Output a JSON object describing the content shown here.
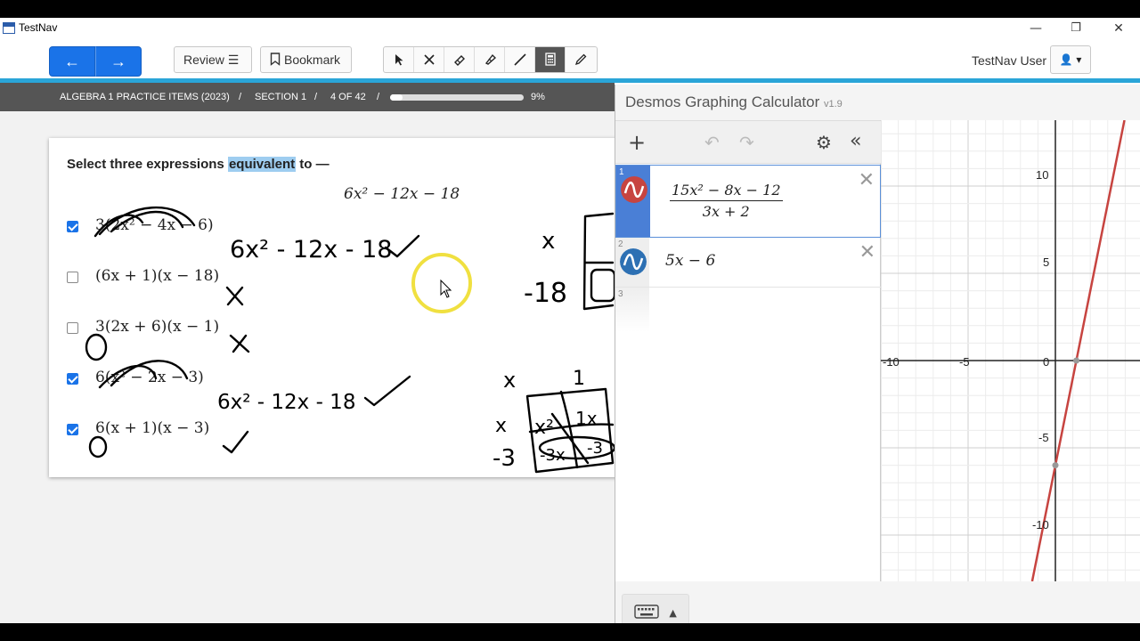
{
  "window": {
    "app_title": "TestNav",
    "minimize": "—",
    "restore": "❐",
    "close": "✕"
  },
  "toolbar": {
    "back": "←",
    "forward": "→",
    "review_label": "Review",
    "bookmark_label": "Bookmark",
    "user_name": "TestNav User",
    "user_menu": "👤 ▾"
  },
  "section_bar": {
    "course": "ALGEBRA 1 PRACTICE ITEMS (2023)",
    "section": "SECTION 1",
    "position": "4 OF 42",
    "percent_text": "9%",
    "progress": 0.09
  },
  "question": {
    "prefix": "Select three expressions ",
    "highlight": "equivalent",
    "suffix": " to —",
    "target": "6x² − 12x − 18",
    "options": [
      {
        "text": "3(2x² − 4x − 6)",
        "checked": true
      },
      {
        "text": "(6x + 1)(x − 18)",
        "checked": false
      },
      {
        "text": "3(2x + 6)(x − 1)",
        "checked": false
      },
      {
        "text": "6(x² − 2x − 3)",
        "checked": true
      },
      {
        "text": "6(x + 1)(x − 3)",
        "checked": true
      }
    ]
  },
  "annotations": {
    "work1": "6x² - 12x - 18",
    "work2": "6x² - 12x - 18",
    "box_labels": [
      "x",
      "1",
      "x",
      "-3",
      "x²",
      "1x",
      "-3x",
      "-3"
    ],
    "side_labels": [
      "x",
      "-18"
    ]
  },
  "desmos": {
    "title": "Desmos Graphing Calculator",
    "version": "v1.9",
    "expressions": [
      {
        "index": "1",
        "numerator": "15x² − 8x − 12",
        "denominator": "3x + 2",
        "color": "#c74440"
      },
      {
        "index": "2",
        "text": "5x − 6",
        "color": "#2d70b3"
      },
      {
        "index": "3"
      }
    ],
    "x_ticks": [
      "-10",
      "-5",
      "0"
    ],
    "y_ticks": [
      "10",
      "5",
      "-5",
      "-10"
    ],
    "line": {
      "slope": 5,
      "intercept": -6,
      "color": "#c74440"
    }
  }
}
